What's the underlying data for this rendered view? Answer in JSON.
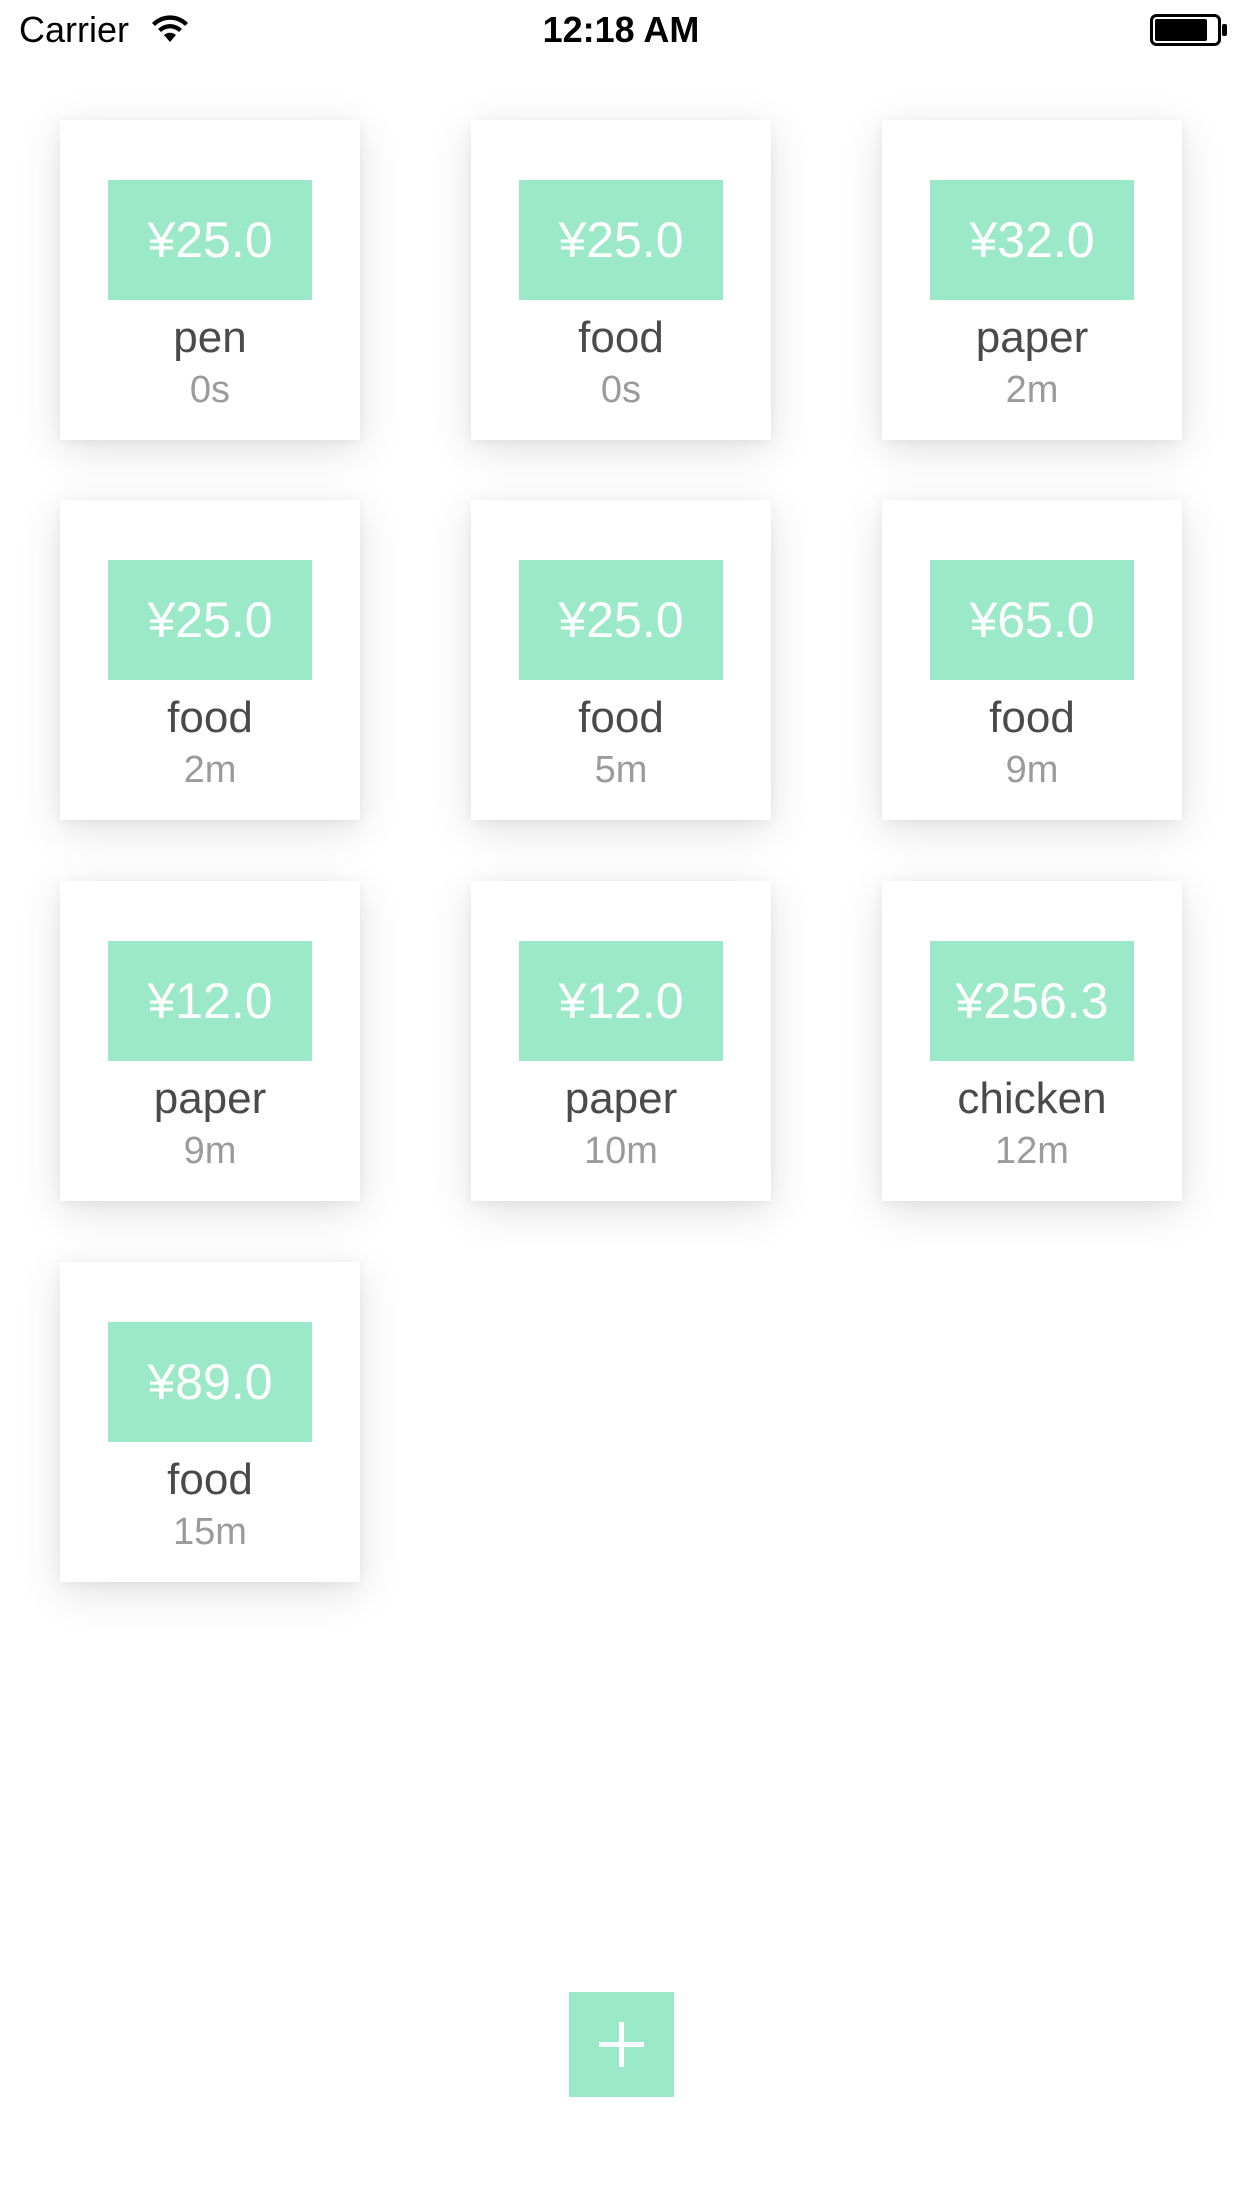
{
  "status_bar": {
    "carrier": "Carrier",
    "time": "12:18 AM",
    "wifi_icon": "wifi-icon",
    "battery_icon": "battery-icon"
  },
  "colors": {
    "accent": "#9ce9c9",
    "name_text": "#4a4a4a",
    "time_text": "#9b9b9b",
    "background": "#ffffff"
  },
  "records": [
    {
      "price": "¥25.0",
      "name": "pen",
      "time": "0s"
    },
    {
      "price": "¥25.0",
      "name": "food",
      "time": "0s"
    },
    {
      "price": "¥32.0",
      "name": "paper",
      "time": "2m"
    },
    {
      "price": "¥25.0",
      "name": "food",
      "time": "2m"
    },
    {
      "price": "¥25.0",
      "name": "food",
      "time": "5m"
    },
    {
      "price": "¥65.0",
      "name": "food",
      "time": "9m"
    },
    {
      "price": "¥12.0",
      "name": "paper",
      "time": "9m"
    },
    {
      "price": "¥12.0",
      "name": "paper",
      "time": "10m"
    },
    {
      "price": "¥256.3",
      "name": "chicken",
      "time": "12m"
    },
    {
      "price": "¥89.0",
      "name": "food",
      "time": "15m"
    }
  ],
  "add_button": {
    "icon": "plus-icon"
  }
}
